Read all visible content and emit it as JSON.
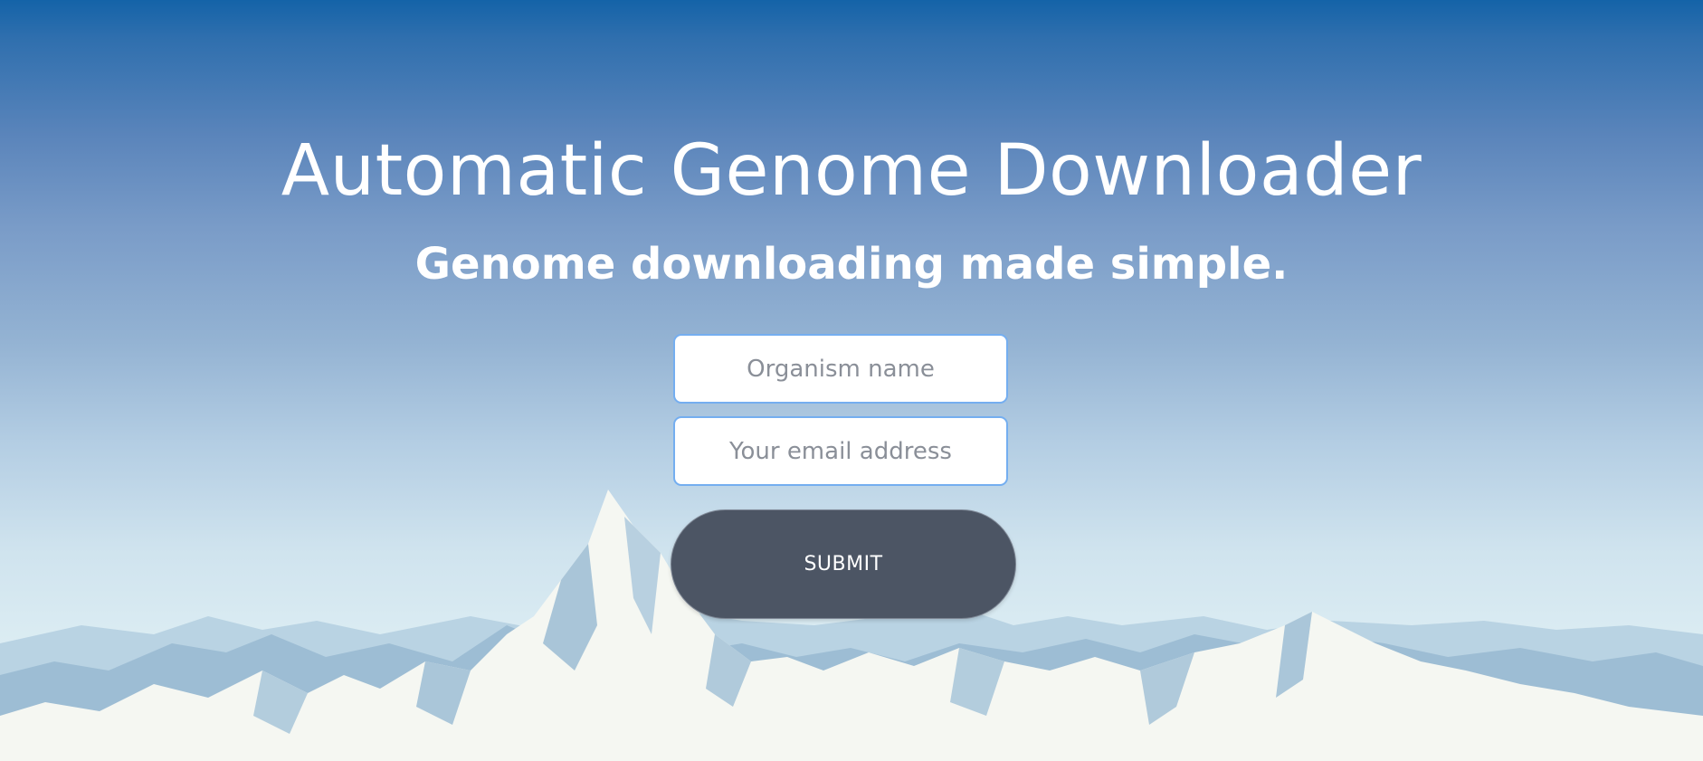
{
  "header": {
    "title": "Automatic Genome Downloader",
    "subtitle": "Genome downloading made simple."
  },
  "form": {
    "organism_placeholder": "Organism name",
    "email_placeholder": "Your email address",
    "submit_label": "SUBMIT"
  },
  "colors": {
    "sky_top": "#1463a8",
    "sky_bottom": "#e8f3f6",
    "field_border": "#74aef0",
    "button_bg": "#4c5564",
    "text": "#ffffff"
  }
}
